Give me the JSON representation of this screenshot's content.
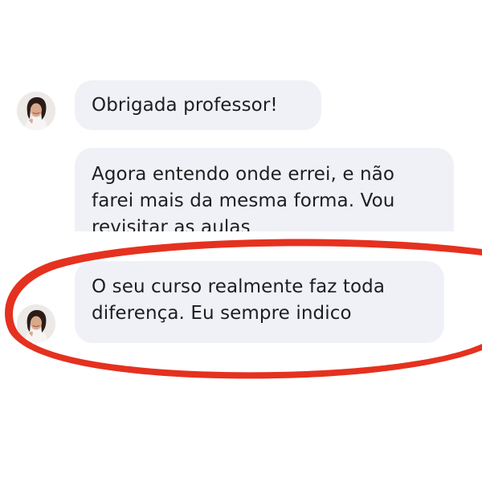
{
  "conversation": {
    "messages": [
      {
        "text": "Obrigada professor!"
      },
      {
        "text": "Agora entendo onde errei, e não farei mais da mesma forma. Vou revisitar as aulas"
      },
      {
        "text": "O seu curso realmente faz toda diferença. Eu sempre indico"
      }
    ],
    "avatar_icon": "user-avatar-woman",
    "highlight_color": "#e5311f",
    "bubble_color": "#f0f1f6"
  }
}
